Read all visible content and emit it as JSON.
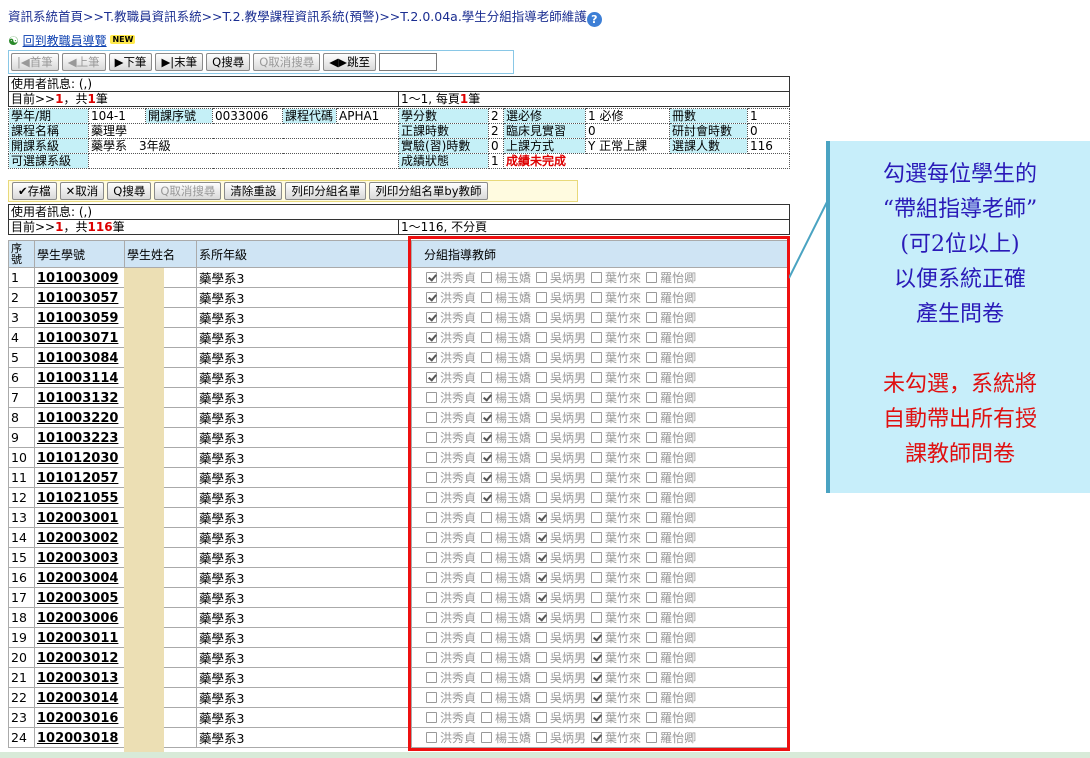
{
  "breadcrumb": "資訊系統首頁>>T.教職員資訊系統>>T.2.教學課程資訊系統(預警)>>T.2.0.04a.學生分組指導老師維護",
  "back_link": "回到教職員導覽",
  "new_badge": "NEW",
  "toolbar": {
    "first": "首筆",
    "prev": "上筆",
    "next": "下筆",
    "last": "末筆",
    "search": "搜尋",
    "cancel_search": "取消搜尋",
    "jump": "跳至"
  },
  "info_top": {
    "msg": "使用者訊息: (,)",
    "record_prefix": "目前>>",
    "record_num": "1",
    "record_mid": "，共",
    "record_total": "1",
    "record_suffix": "筆",
    "page_info_a": "1～1, 每頁",
    "page_info_num": "1",
    "page_info_b": "筆"
  },
  "course": {
    "year_label": "學年/期",
    "year": "104-1",
    "serial_label": "開課序號",
    "serial": "0033006",
    "code_label": "課程代碼",
    "code": "APHA1",
    "credit_label": "學分數",
    "credit": "2",
    "type_label": "選必修",
    "type": "1 必修",
    "vol_label": "冊數",
    "vol": "1",
    "name_label": "課程名稱",
    "name": "藥理學",
    "hours_label": "正課時數",
    "hours": "2",
    "clinic_label": "臨床見實習",
    "clinic": "0",
    "seminar_label": "研討會時數",
    "seminar": "0",
    "dept_label": "開課系級",
    "dept": "藥學系　3年級",
    "lab_label": "實驗(習)時數",
    "lab": "0",
    "method_label": "上課方式",
    "method": "Y 正常上課",
    "enroll_label": "選課人數",
    "enroll": "116",
    "avail_label": "可選課系級",
    "avail": "",
    "grade_label": "成績狀態",
    "grade_code": "1",
    "grade_text": "成績未完成"
  },
  "actions": {
    "save": "存檔",
    "cancel": "取消",
    "search": "搜尋",
    "cancel_search": "取消搜尋",
    "reset": "清除重設",
    "print_group": "列印分組名單",
    "print_by_teacher": "列印分組名單by教師"
  },
  "info_list": {
    "msg": "使用者訊息: (,)",
    "record_prefix": "目前>>",
    "record_num": "1",
    "record_mid": "，共",
    "record_total": "116",
    "record_suffix": "筆",
    "page_info": "1～116, 不分頁"
  },
  "columns": {
    "no": "序號",
    "sid": "學生學號",
    "name": "學生姓名",
    "dept": "系所年級",
    "teacher": "分組指導教師"
  },
  "teachers": [
    "洪秀貞",
    "楊玉嬌",
    "吳炳男",
    "葉竹來",
    "羅怡卿"
  ],
  "students": [
    {
      "no": "1",
      "sid": "101003009",
      "dept": "藥學系3",
      "sel": 0
    },
    {
      "no": "2",
      "sid": "101003057",
      "dept": "藥學系3",
      "sel": 0
    },
    {
      "no": "3",
      "sid": "101003059",
      "dept": "藥學系3",
      "sel": 0
    },
    {
      "no": "4",
      "sid": "101003071",
      "dept": "藥學系3",
      "sel": 0
    },
    {
      "no": "5",
      "sid": "101003084",
      "dept": "藥學系3",
      "sel": 0
    },
    {
      "no": "6",
      "sid": "101003114",
      "dept": "藥學系3",
      "sel": 0
    },
    {
      "no": "7",
      "sid": "101003132",
      "dept": "藥學系3",
      "sel": 1
    },
    {
      "no": "8",
      "sid": "101003220",
      "dept": "藥學系3",
      "sel": 1
    },
    {
      "no": "9",
      "sid": "101003223",
      "dept": "藥學系3",
      "sel": 1
    },
    {
      "no": "10",
      "sid": "101012030",
      "dept": "藥學系3",
      "sel": 1
    },
    {
      "no": "11",
      "sid": "101012057",
      "dept": "藥學系3",
      "sel": 1
    },
    {
      "no": "12",
      "sid": "101021055",
      "dept": "藥學系3",
      "sel": 1
    },
    {
      "no": "13",
      "sid": "102003001",
      "dept": "藥學系3",
      "sel": 2
    },
    {
      "no": "14",
      "sid": "102003002",
      "dept": "藥學系3",
      "sel": 2
    },
    {
      "no": "15",
      "sid": "102003003",
      "dept": "藥學系3",
      "sel": 2
    },
    {
      "no": "16",
      "sid": "102003004",
      "dept": "藥學系3",
      "sel": 2
    },
    {
      "no": "17",
      "sid": "102003005",
      "dept": "藥學系3",
      "sel": 2
    },
    {
      "no": "18",
      "sid": "102003006",
      "dept": "藥學系3",
      "sel": 2
    },
    {
      "no": "19",
      "sid": "102003011",
      "dept": "藥學系3",
      "sel": 3
    },
    {
      "no": "20",
      "sid": "102003012",
      "dept": "藥學系3",
      "sel": 3
    },
    {
      "no": "21",
      "sid": "102003013",
      "dept": "藥學系3",
      "sel": 3
    },
    {
      "no": "22",
      "sid": "102003014",
      "dept": "藥學系3",
      "sel": 3
    },
    {
      "no": "23",
      "sid": "102003016",
      "dept": "藥學系3",
      "sel": 3
    },
    {
      "no": "24",
      "sid": "102003018",
      "dept": "藥學系3",
      "sel": 3
    }
  ],
  "callout": {
    "line1": "勾選每位學生的",
    "line2": "“帶組指導老師”",
    "line3": "(可2位以上)",
    "line4": "以便系統正確",
    "line5": "產生問卷",
    "line6": "未勾選，系統將",
    "line7": "自動帶出所有授",
    "line8": "課教師問卷"
  },
  "colors": {
    "label_bg": "#c5f0f7",
    "header_bg": "#cfe4f4",
    "highlight_frame": "#ee1010",
    "callout_bg": "#c7eefa",
    "callout_text": "#2a1ab8",
    "callout_red": "#e01010"
  }
}
